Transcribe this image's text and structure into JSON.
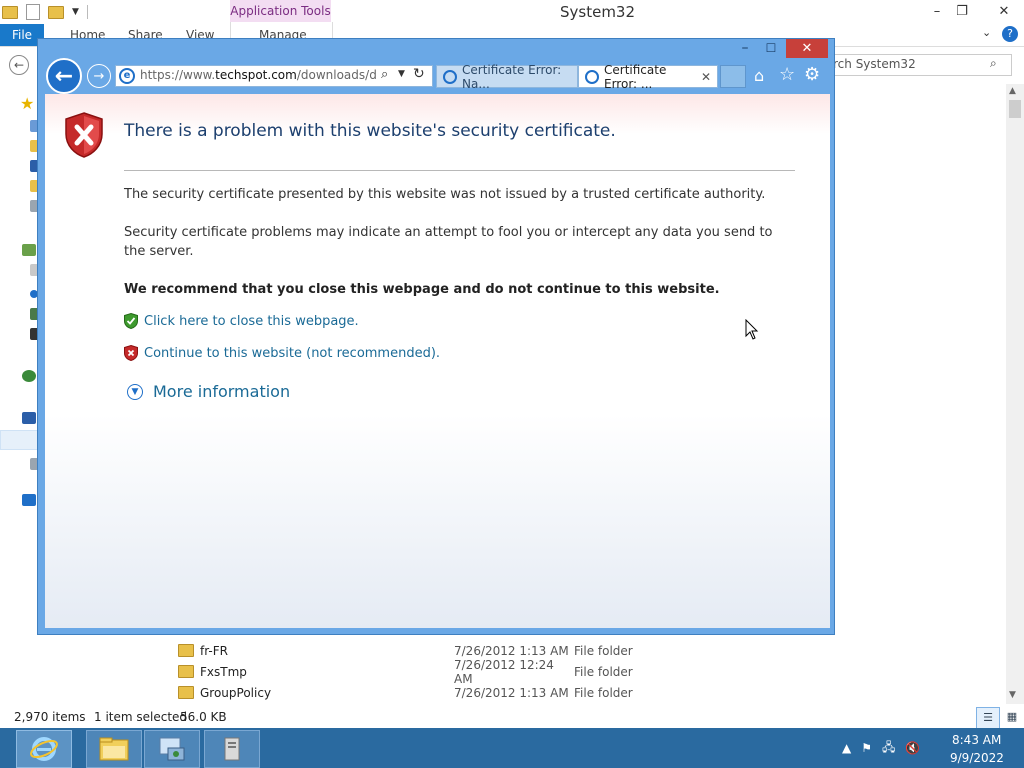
{
  "explorer": {
    "title": "System32",
    "app_tools_label": "Application Tools",
    "ribbon_tabs": {
      "file": "File",
      "home": "Home",
      "share": "Share",
      "view": "View",
      "manage": "Manage"
    },
    "search_placeholder": "rch System32",
    "files": [
      {
        "name": "fr-FR",
        "date": "7/26/2012 1:13 AM",
        "type": "File folder"
      },
      {
        "name": "FxsTmp",
        "date": "7/26/2012 12:24 AM",
        "type": "File folder"
      },
      {
        "name": "GroupPolicy",
        "date": "7/26/2012 1:13 AM",
        "type": "File folder"
      }
    ],
    "status": {
      "items": "2,970 items",
      "selected": "1 item selected",
      "size": "56.0 KB"
    },
    "window_controls": {
      "minimize": "–",
      "restore": "❐",
      "close": "✕"
    }
  },
  "ie": {
    "address": {
      "prefix": "https://www.",
      "domain": "techspot.com",
      "suffix": "/downloads/dow"
    },
    "tabs": [
      {
        "label": "Certificate Error: Na...",
        "active": false
      },
      {
        "label": "Certificate Error: ...",
        "active": true
      }
    ],
    "page": {
      "title": "There is a problem with this website's security certificate.",
      "paragraph1": "The security certificate presented by this website was not issued by a trusted certificate authority.",
      "paragraph2": "Security certificate problems may indicate an attempt to fool you or intercept any data you send to the server.",
      "recommendation": "We recommend that you close this webpage and do not continue to this website.",
      "close_link": "Click here to close this webpage.",
      "continue_link": "Continue to this website (not recommended).",
      "more_info": "More information"
    }
  },
  "taskbar": {
    "time": "8:43 AM",
    "date": "9/9/2022"
  },
  "colors": {
    "ie_frame": "#6aa8e6",
    "ie_close": "#c7403a",
    "taskbar": "#2a6aa0",
    "link": "#1a6a96",
    "title_text": "#1c3f6e",
    "file_tab": "#1979ca"
  },
  "icons": [
    "folder-icon",
    "ie-icon",
    "shield-error-icon",
    "shield-ok-icon",
    "home-icon",
    "star-icon",
    "gear-icon",
    "search-icon",
    "refresh-icon",
    "flag-icon",
    "network-icon",
    "volume-mute-icon"
  ]
}
